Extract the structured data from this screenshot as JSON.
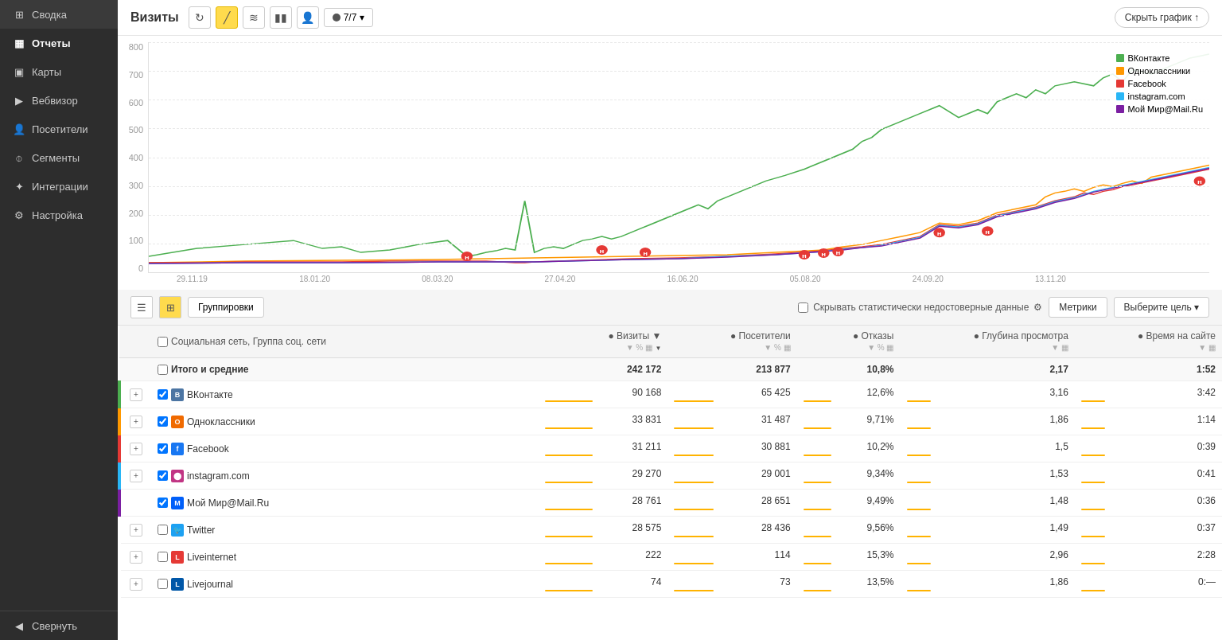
{
  "sidebar": {
    "items": [
      {
        "id": "summary",
        "label": "Сводка",
        "icon": "grid"
      },
      {
        "id": "reports",
        "label": "Отчеты",
        "icon": "bar-chart",
        "active": true
      },
      {
        "id": "maps",
        "label": "Карты",
        "icon": "map"
      },
      {
        "id": "webvisor",
        "label": "Вебвизор",
        "icon": "play"
      },
      {
        "id": "visitors",
        "label": "Посетители",
        "icon": "person"
      },
      {
        "id": "segments",
        "label": "Сегменты",
        "icon": "filter"
      },
      {
        "id": "integrations",
        "label": "Интеграции",
        "icon": "puzzle"
      },
      {
        "id": "settings",
        "label": "Настройка",
        "icon": "gear"
      }
    ],
    "collapse_label": "Свернуть"
  },
  "header": {
    "title": "Визиты",
    "period": "7/7",
    "hide_chart_label": "Скрыть график ↑"
  },
  "chart": {
    "y_axis": [
      "800",
      "700",
      "600",
      "500",
      "400",
      "300",
      "200",
      "100",
      "0"
    ],
    "x_axis": [
      "29.11.19",
      "18.01.20",
      "08.03.20",
      "27.04.20",
      "16.06.20",
      "05.08.20",
      "24.09.20",
      "13.11.20"
    ],
    "legend": [
      {
        "label": "ВКонтакте",
        "color": "#4caf50"
      },
      {
        "label": "Одноклассники",
        "color": "#ff9800"
      },
      {
        "label": "Facebook",
        "color": "#e53935"
      },
      {
        "label": "instagram.com",
        "color": "#29b6f6"
      },
      {
        "label": "Мой Мир@Mail.Ru",
        "color": "#7b1fa2"
      }
    ]
  },
  "table_toolbar": {
    "groupings_label": "Группировки",
    "hide_unreliable_label": "Скрывать статистически недостоверные данные",
    "metrics_label": "Метрики",
    "goal_label": "Выберите цель"
  },
  "table": {
    "header_col": "Социальная сеть, Группа соц. сети",
    "columns": [
      {
        "id": "visits",
        "label": "Визиты",
        "sortable": true
      },
      {
        "id": "visitors",
        "label": "Посетители"
      },
      {
        "id": "bounces",
        "label": "Отказы"
      },
      {
        "id": "depth",
        "label": "Глубина просмотра"
      },
      {
        "id": "time",
        "label": "Время на сайте"
      }
    ],
    "total_row": {
      "label": "Итого и средние",
      "visits": "242 172",
      "visitors": "213 877",
      "bounces": "10,8%",
      "depth": "2,17",
      "time": "1:52"
    },
    "rows": [
      {
        "id": "vkontakte",
        "color": "#4caf50",
        "has_expand": true,
        "checked": true,
        "icon_bg": "#4c75a3",
        "icon_text": "В",
        "name": "ВКонтакте",
        "visits": "90 168",
        "visits_bar": "#ffb300",
        "visitors": "65 425",
        "visitors_bar": "#ffb300",
        "bounces": "12,6%",
        "bounces_bar": "#ffb300",
        "depth": "3,16",
        "depth_bar": "#ffb300",
        "time": "3:42",
        "time_bar": "#ffb300"
      },
      {
        "id": "odnoklassniki",
        "color": "#ff9800",
        "has_expand": true,
        "checked": true,
        "icon_bg": "#f06a00",
        "icon_text": "О",
        "name": "Одноклассники",
        "visits": "33 831",
        "visits_bar": "#ffb300",
        "visitors": "31 487",
        "visitors_bar": "#ffb300",
        "bounces": "9,71%",
        "bounces_bar": "#ffb300",
        "depth": "1,86",
        "depth_bar": "#ffb300",
        "time": "1:14",
        "time_bar": "#ffb300"
      },
      {
        "id": "facebook",
        "color": "#e53935",
        "has_expand": true,
        "checked": true,
        "icon_bg": "#1877f2",
        "icon_text": "f",
        "name": "Facebook",
        "visits": "31 211",
        "visits_bar": "#ffb300",
        "visitors": "30 881",
        "visitors_bar": "#ffb300",
        "bounces": "10,2%",
        "bounces_bar": "#ffb300",
        "depth": "1,5",
        "depth_bar": "#ffb300",
        "time": "0:39",
        "time_bar": "#ffb300"
      },
      {
        "id": "instagram",
        "color": "#29b6f6",
        "has_expand": true,
        "checked": true,
        "icon_bg": "#c13584",
        "icon_text": "I",
        "name": "instagram.com",
        "visits": "29 270",
        "visits_bar": "#ffb300",
        "visitors": "29 001",
        "visitors_bar": "#ffb300",
        "bounces": "9,34%",
        "bounces_bar": "#ffb300",
        "depth": "1,53",
        "depth_bar": "#ffb300",
        "time": "0:41",
        "time_bar": "#ffb300"
      },
      {
        "id": "mailru",
        "color": "#7b1fa2",
        "has_expand": false,
        "checked": true,
        "icon_bg": "#005ff9",
        "icon_text": "М",
        "name": "Мой Мир@Mail.Ru",
        "visits": "28 761",
        "visits_bar": "#ffb300",
        "visitors": "28 651",
        "visitors_bar": "#ffb300",
        "bounces": "9,49%",
        "bounces_bar": "#ffb300",
        "depth": "1,48",
        "depth_bar": "#ffb300",
        "time": "0:36",
        "time_bar": "#ffb300"
      },
      {
        "id": "twitter",
        "color": "#e0e0e0",
        "has_expand": true,
        "checked": false,
        "icon_bg": "#1da1f2",
        "icon_text": "T",
        "name": "Twitter",
        "visits": "28 575",
        "visits_bar": "#ffb300",
        "visitors": "28 436",
        "visitors_bar": "#ffb300",
        "bounces": "9,56%",
        "bounces_bar": "#ffb300",
        "depth": "1,49",
        "depth_bar": "#ffb300",
        "time": "0:37",
        "time_bar": "#ffb300"
      },
      {
        "id": "liveinternet",
        "color": "#e0e0e0",
        "has_expand": true,
        "checked": false,
        "icon_bg": "#e53935",
        "icon_text": "L",
        "name": "Liveinternet",
        "visits": "222",
        "visits_bar": "#ffb300",
        "visitors": "114",
        "visitors_bar": "#ffb300",
        "bounces": "15,3%",
        "bounces_bar": "#ffb300",
        "depth": "2,96",
        "depth_bar": "#ffb300",
        "time": "2:28",
        "time_bar": "#ffb300"
      },
      {
        "id": "livejournal",
        "color": "#e0e0e0",
        "has_expand": true,
        "checked": false,
        "icon_bg": "#0057a8",
        "icon_text": "L",
        "name": "Livejournal",
        "visits": "74",
        "visits_bar": "#ffb300",
        "visitors": "73",
        "visitors_bar": "#ffb300",
        "bounces": "13,5%",
        "bounces_bar": "#ffb300",
        "depth": "1,86",
        "depth_bar": "#ffb300",
        "time": "0:—",
        "time_bar": "#ffb300"
      }
    ]
  }
}
